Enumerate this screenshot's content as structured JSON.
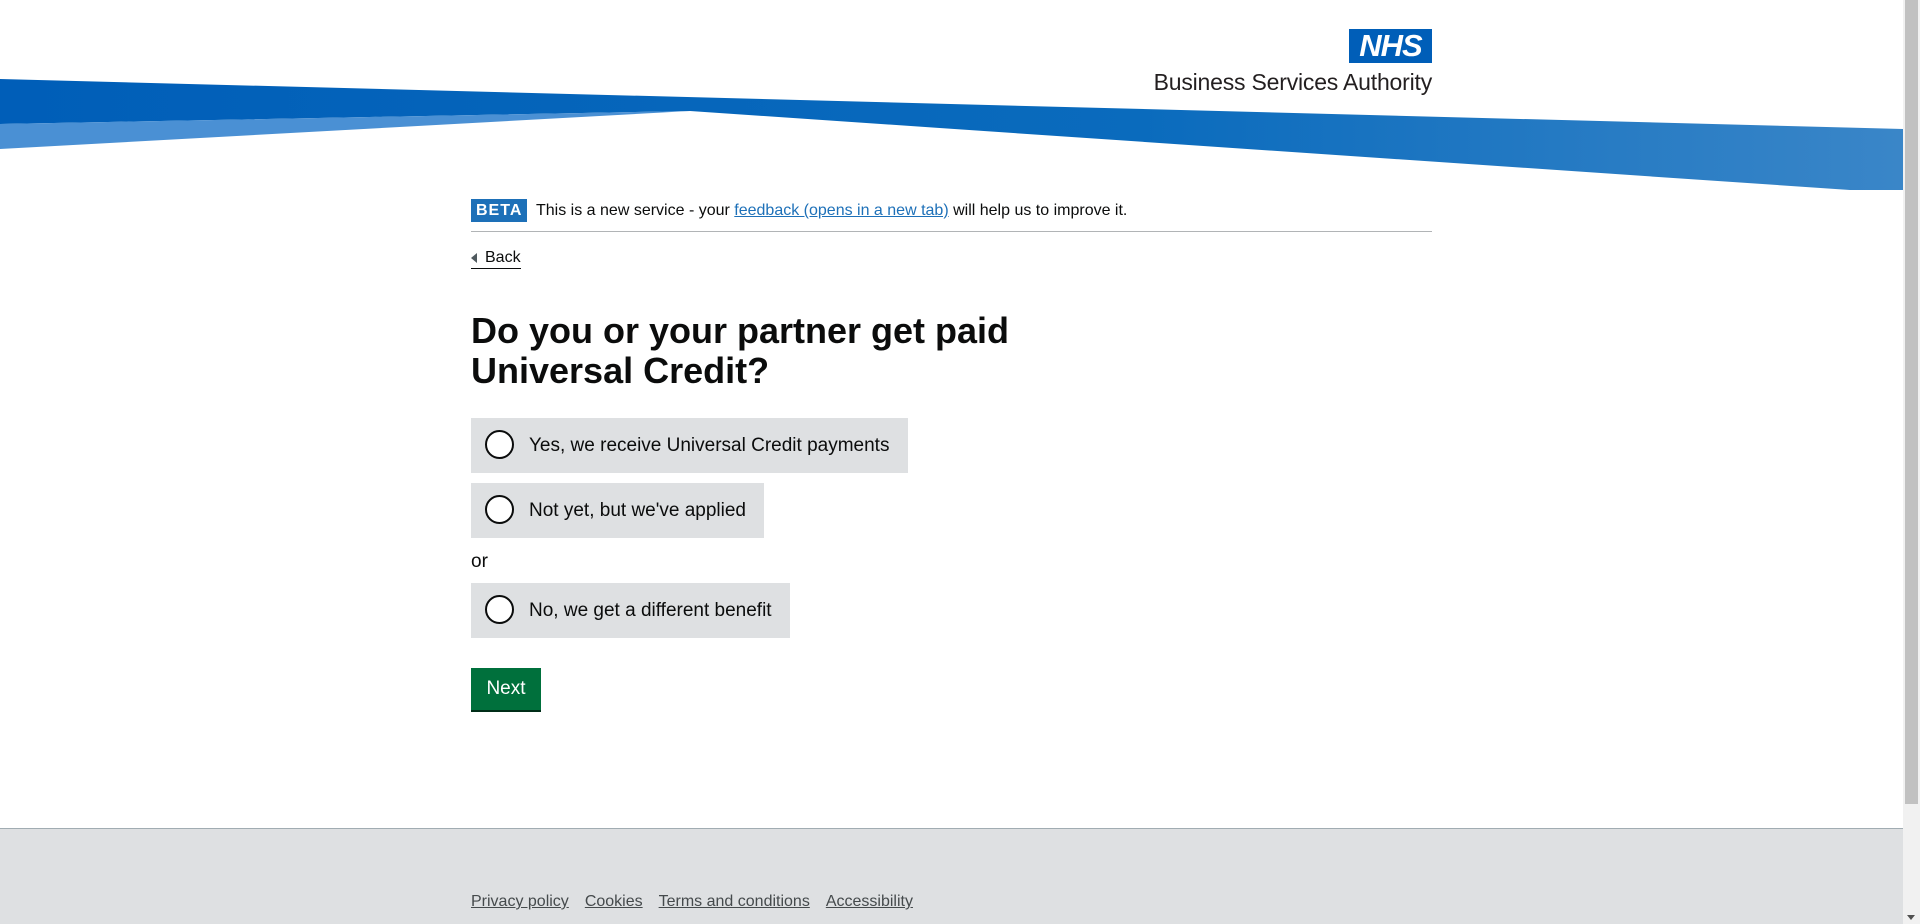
{
  "header": {
    "logo_mark": "NHS",
    "org_name": "Business Services Authority",
    "colors": {
      "brand": "#005eb8",
      "swoosh_dark": "#005eb8",
      "swoosh_light": "#41b6e6"
    }
  },
  "phase_banner": {
    "tag": "BETA",
    "text_before": "This is a new service - your ",
    "link_text": "feedback (opens in a new tab)",
    "text_after": " will help us to improve it."
  },
  "back_link": {
    "label": "Back"
  },
  "question": {
    "heading": "Do you or your partner get paid Universal Credit?",
    "options": [
      {
        "label": "Yes, we receive Universal Credit payments",
        "selected": false
      },
      {
        "label": "Not yet, but we've applied",
        "selected": false
      },
      {
        "label": "No, we get a different benefit",
        "selected": false
      }
    ],
    "divider": "or"
  },
  "actions": {
    "next_label": "Next",
    "button_color": "#00703c"
  },
  "footer": {
    "links": [
      "Privacy policy",
      "Cookies",
      "Terms and conditions",
      "Accessibility"
    ]
  },
  "icons": {
    "back": "chevron-left-icon",
    "radio": "radio-circle-icon"
  }
}
